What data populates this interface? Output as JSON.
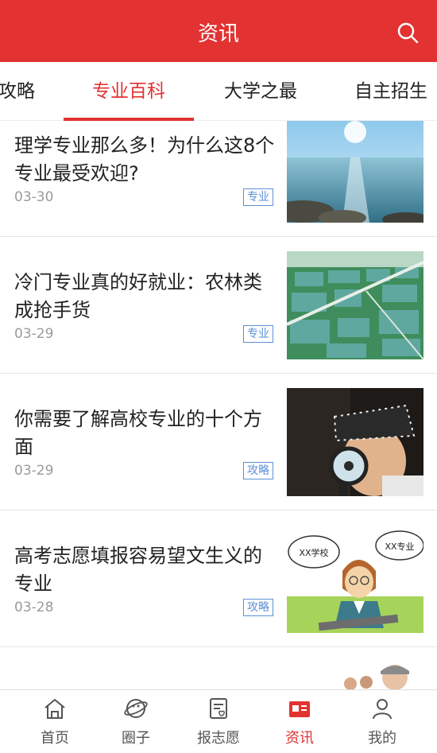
{
  "header": {
    "title": "资讯",
    "search_icon": "search-icon"
  },
  "tabs": [
    {
      "label": "攻略"
    },
    {
      "label": "专业百科",
      "active": true
    },
    {
      "label": "大学之最"
    },
    {
      "label": "自主招生"
    }
  ],
  "articles": [
    {
      "title": "理学专业那么多！为什么这8个专业最受欢迎?",
      "date": "03-30",
      "tag": "专业"
    },
    {
      "title": "冷门专业真的好就业：农林类成抢手货",
      "date": "03-29",
      "tag": "专业"
    },
    {
      "title": "你需要了解高校专业的十个方面",
      "date": "03-29",
      "tag": "攻略"
    },
    {
      "title": "高考志愿填报容易望文生义的专业",
      "date": "03-28",
      "tag": "攻略"
    }
  ],
  "cartoon": {
    "left_bubble": "XX学校",
    "right_bubble": "XX专业"
  },
  "bottom_nav": [
    {
      "label": "首页",
      "icon": "home-icon"
    },
    {
      "label": "圈子",
      "icon": "planet-icon"
    },
    {
      "label": "报志愿",
      "icon": "form-heart-icon"
    },
    {
      "label": "资讯",
      "icon": "news-icon",
      "active": true
    },
    {
      "label": "我的",
      "icon": "person-icon"
    }
  ],
  "colors": {
    "brand_red": "#e23232",
    "tag_blue": "#5b8fd6",
    "date_gray": "#9a9a9a"
  }
}
